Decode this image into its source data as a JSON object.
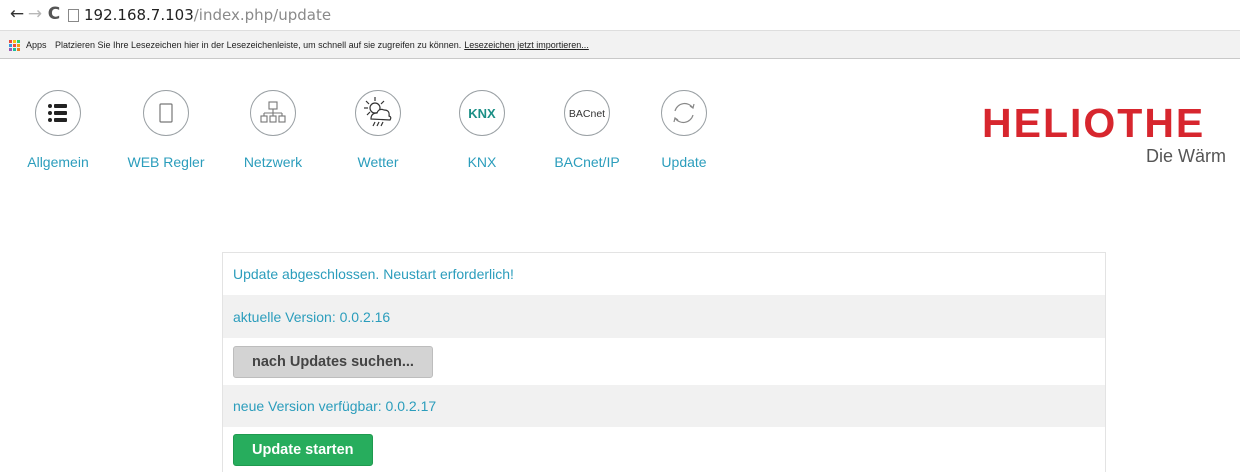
{
  "browser": {
    "url_host": "192.168.7.103",
    "url_path": "/index.php/update",
    "bookmarks": {
      "apps_label": "Apps",
      "hint_text": "Platzieren Sie Ihre Lesezeichen hier in der Lesezeichenleiste, um schnell auf sie zugreifen zu können.",
      "import_link": "Lesezeichen jetzt importieren...",
      "apps_colors": [
        "#e84c3d",
        "#f1c40f",
        "#2ecc71",
        "#3498db",
        "#e84c3d",
        "#f39c12",
        "#9b59b6",
        "#1abc9c",
        "#e67e22"
      ]
    }
  },
  "nav": {
    "items": [
      {
        "label": "Allgemein",
        "icon": "list-icon"
      },
      {
        "label": "WEB Regler",
        "icon": "tablet-icon"
      },
      {
        "label": "Netzwerk",
        "icon": "network-icon"
      },
      {
        "label": "Wetter",
        "icon": "weather-icon"
      },
      {
        "label": "KNX",
        "icon": "knx-icon",
        "icon_text": "KNX"
      },
      {
        "label": "BACnet/IP",
        "icon": "bacnet-icon",
        "icon_text": "BACnet"
      },
      {
        "label": "Update",
        "icon": "refresh-icon"
      }
    ],
    "label_color": "#2b9dbc"
  },
  "brand": {
    "logo_text": "HELIOTHE",
    "tagline": "Die Wärm",
    "logo_color": "#d7262e"
  },
  "update": {
    "status": "Update abgeschlossen. Neustart erforderlich!",
    "current_version": "aktuelle Version: 0.0.2.16",
    "search_button": "nach Updates suchen...",
    "new_version": "neue Version verfügbar: 0.0.2.17",
    "start_button": "Update starten",
    "start_button_color": "#27ad5d"
  }
}
